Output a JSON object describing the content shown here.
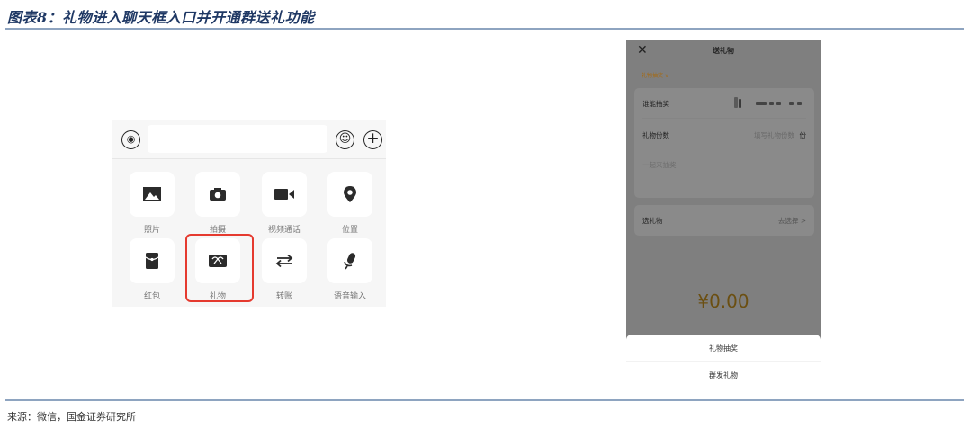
{
  "figure": {
    "title": "图表8：礼物进入聊天框入口并开通群送礼功能",
    "source": "来源：微信，国金证券研究所"
  },
  "chat_panel": {
    "tools": [
      {
        "label": "照片",
        "icon": "image-icon"
      },
      {
        "label": "拍摄",
        "icon": "camera-icon"
      },
      {
        "label": "视频通话",
        "icon": "video-icon"
      },
      {
        "label": "位置",
        "icon": "location-icon"
      },
      {
        "label": "红包",
        "icon": "red-packet-icon"
      },
      {
        "label": "礼物",
        "icon": "gift-icon"
      },
      {
        "label": "转账",
        "icon": "transfer-icon"
      },
      {
        "label": "语音输入",
        "icon": "microphone-icon"
      }
    ]
  },
  "gift_panel": {
    "title": "送礼物",
    "mode_label": "礼物抽奖 ∨",
    "who_label": "谁能抽奖",
    "count_label": "礼物份数",
    "count_placeholder": "填写礼物份数",
    "count_unit": "份",
    "note_placeholder": "一起来抽奖",
    "gift_label": "选礼物",
    "gift_action": "去选择 >",
    "amount": "¥0.00",
    "sheet_options": [
      "礼物抽奖",
      "群发礼物"
    ]
  },
  "colors": {
    "title": "#1f3864",
    "highlight": "#e53a2f",
    "rule": "#8ea4c0"
  }
}
